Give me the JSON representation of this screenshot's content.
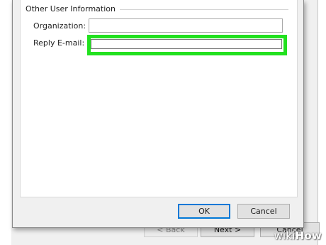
{
  "wizard": {
    "back_label": "< Back",
    "next_label": "Next >",
    "cancel_label": "Cancel"
  },
  "dialog": {
    "group_title": "Other User Information",
    "fields": [
      {
        "label": "Organization:",
        "value": ""
      },
      {
        "label": "Reply E-mail:",
        "value": ""
      }
    ],
    "ok_label": "OK",
    "cancel_label": "Cancel",
    "highlight_color": "#22e11f",
    "focus_color": "#0078d7"
  },
  "watermark": {
    "part1": "wiki",
    "part2": "How"
  }
}
